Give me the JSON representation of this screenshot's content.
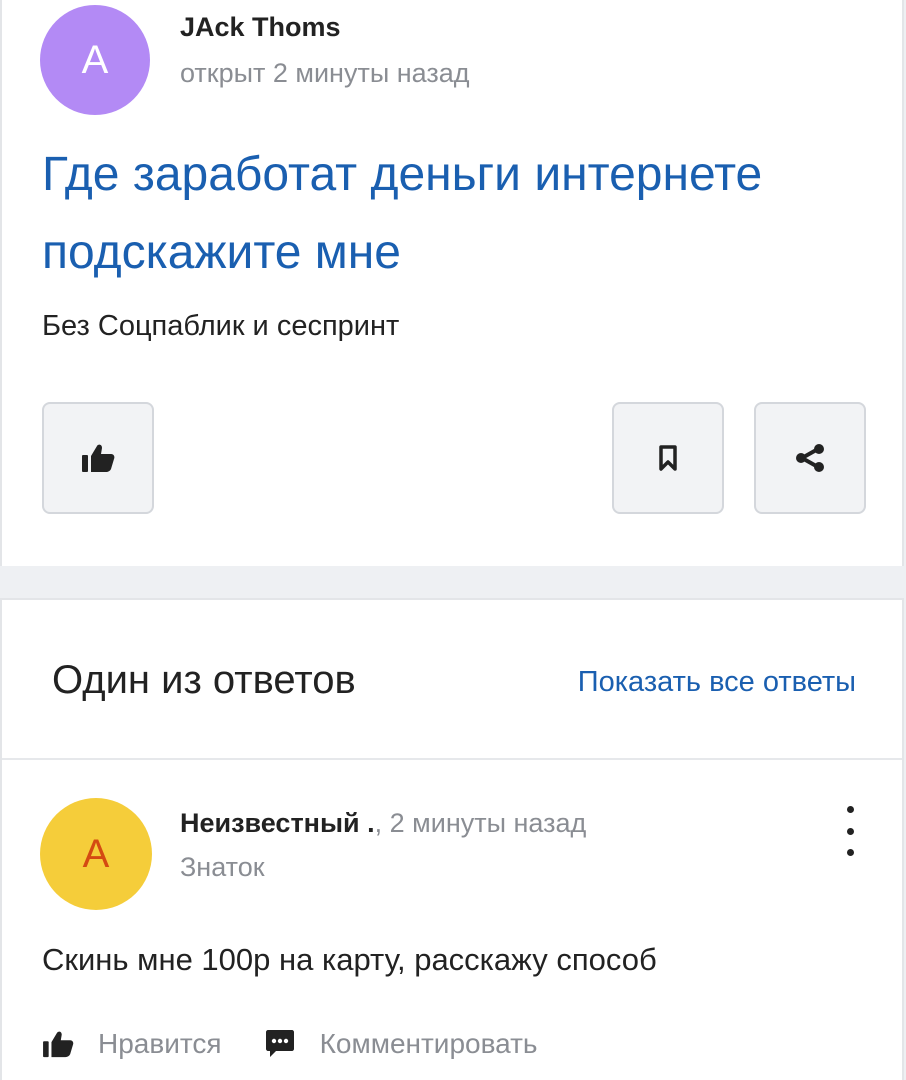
{
  "question": {
    "avatar_letter": "A",
    "author": "JAck Thoms",
    "meta": "открыт 2 минуты назад",
    "title": "Где заработат деньги интернете подскажите мне",
    "body": "Без Соцпаблик и сеспринт",
    "icons": {
      "like": "thumbs-up-icon",
      "bookmark": "bookmark-icon",
      "share": "share-icon"
    },
    "colors": {
      "avatar": "#b38af5",
      "title": "#1a5fb0"
    }
  },
  "answers": {
    "header_title": "Один из ответов",
    "show_all_label": "Показать все ответы",
    "answer": {
      "avatar_letter": "A",
      "author": "Неизвестный .",
      "time": ", 2 минуты назад",
      "rank": "Знаток",
      "text": "Скинь мне 100р на карту, расскажу способ",
      "like_label": "Нравится",
      "comment_label": "Комментировать",
      "colors": {
        "avatar": "#f5cd3a",
        "avatar_letter": "#d44a12"
      }
    }
  }
}
